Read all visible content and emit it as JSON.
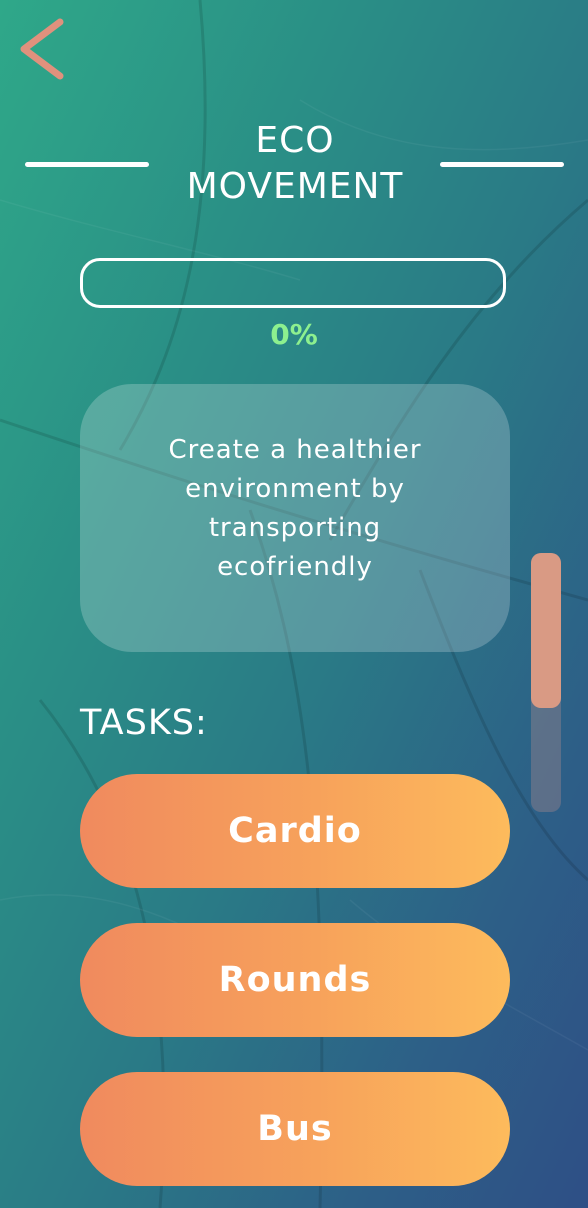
{
  "header": {
    "back_icon": "chevron-left-icon",
    "title": "ECO MOVEMENT"
  },
  "progress": {
    "value": 0,
    "label": "0%"
  },
  "description": "Create a healthier environment by transporting ecofriendly",
  "tasks": {
    "label": "TASKS:",
    "items": [
      {
        "label": "Cardio"
      },
      {
        "label": "Rounds"
      },
      {
        "label": "Bus"
      }
    ]
  },
  "colors": {
    "accent": "#86ee8f",
    "button_start": "#f08a5e",
    "button_end": "#fdbb5c",
    "back_arrow": "#e0917d",
    "scroll_thumb": "#d99a84"
  }
}
